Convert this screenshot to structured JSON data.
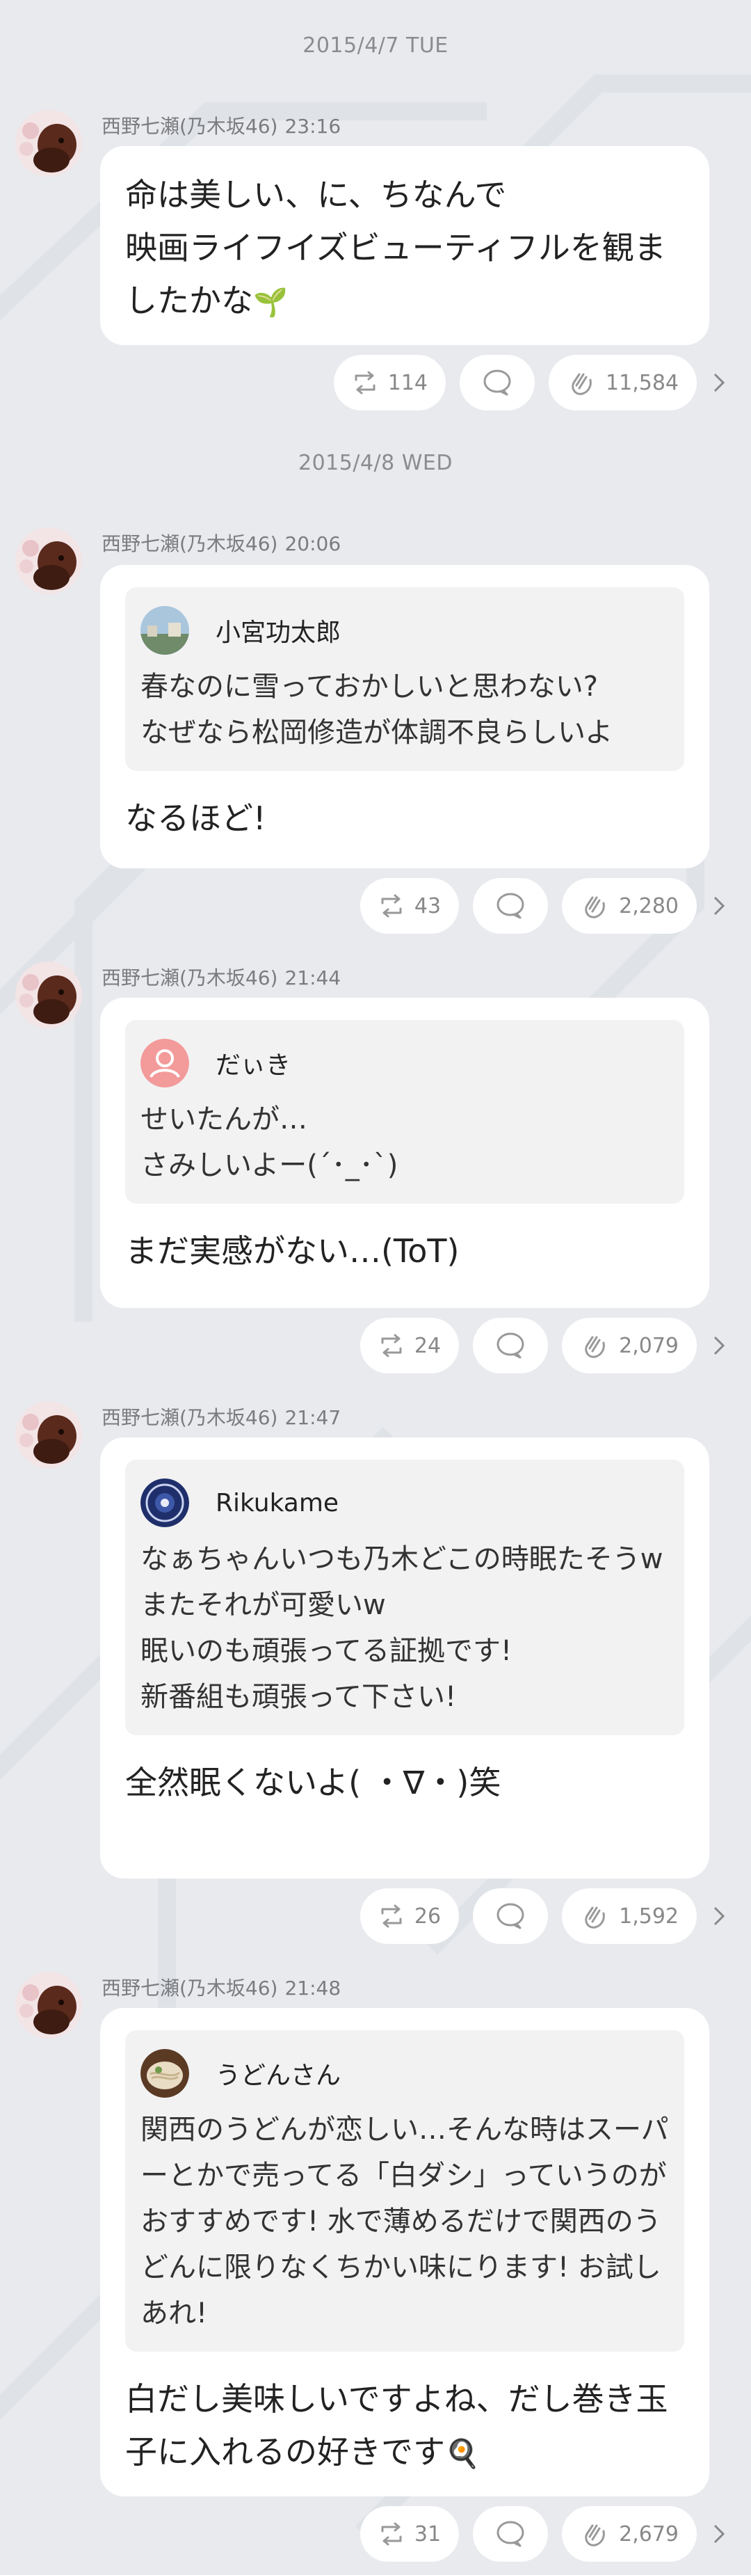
{
  "posts": [
    {
      "date": "2015/4/7 TUE",
      "author": "西野七瀬(乃木坂46)",
      "time": "23:16",
      "text": "命は美しい、に、ちなんで\n映画ライフイズビューティフルを観ましたかな",
      "emoji": "🌱",
      "retweets": "114",
      "claps": "11,584"
    },
    {
      "date": "2015/4/8 WED",
      "author": "西野七瀬(乃木坂46)",
      "time": "20:06",
      "quote_name": "小宮功太郎",
      "quote_text": "春なのに雪っておかしいと思わない?\nなぜなら松岡修造が体調不良らしいよ",
      "text": "なるほど!",
      "retweets": "43",
      "claps": "2,280"
    },
    {
      "author": "西野七瀬(乃木坂46)",
      "time": "21:44",
      "quote_name": "だぃき",
      "quote_text": "せいたんが…\nさみしいよー(´･_･`)",
      "text": "まだ実感がない…(ToT)",
      "retweets": "24",
      "claps": "2,079"
    },
    {
      "author": "西野七瀬(乃木坂46)",
      "time": "21:47",
      "quote_name": "Rikukame",
      "quote_text": "なぁちゃんいつも乃木どこの時眠たそうw\nまたそれが可愛いw\n眠いのも頑張ってる証拠です!\n新番組も頑張って下さい!",
      "text": "全然眠くないよ( ・∇・)笑",
      "retweets": "26",
      "claps": "1,592"
    },
    {
      "author": "西野七瀬(乃木坂46)",
      "time": "21:48",
      "quote_name": "うどんさん",
      "quote_text": "関西のうどんが恋しい…そんな時はスーパーとかで売ってる「白ダシ」っていうのがおすすめです! 水で薄めるだけで関西のうどんに限りなくちかい味にります! お試しあれ!",
      "text": "白だし美味しいですよね、だし巻き玉子に入れるの好きです",
      "emoji": "🍳",
      "retweets": "31",
      "claps": "2,679"
    }
  ]
}
